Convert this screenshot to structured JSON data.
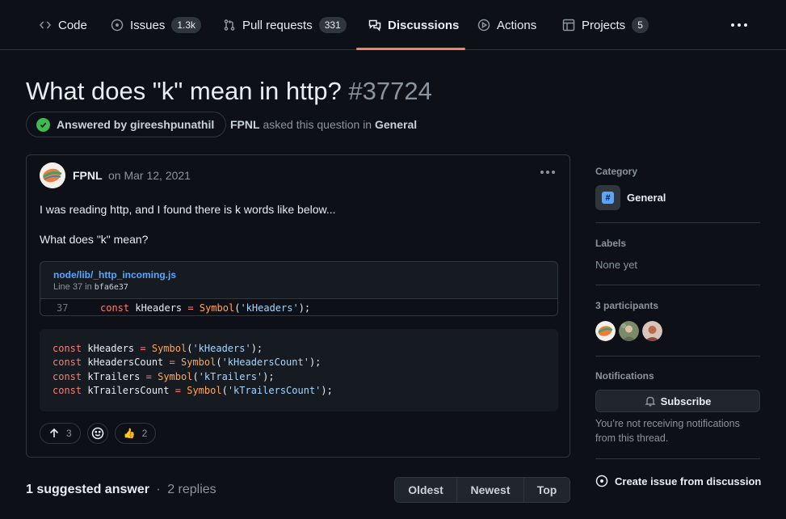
{
  "nav": {
    "tabs": [
      {
        "label": "Code",
        "icon": "code-icon"
      },
      {
        "label": "Issues",
        "icon": "issue-icon",
        "count": "1.3k"
      },
      {
        "label": "Pull requests",
        "icon": "pull-request-icon",
        "count": "331"
      },
      {
        "label": "Discussions",
        "icon": "discussion-icon",
        "active": true
      },
      {
        "label": "Actions",
        "icon": "play-icon"
      },
      {
        "label": "Projects",
        "icon": "table-icon",
        "count": "5"
      }
    ]
  },
  "discussion": {
    "title": "What does \"k\" mean in http?",
    "number": "#37724",
    "answered_by": "Answered by gireeshpunathil",
    "asker": "FPNL",
    "asked_text": "asked this question in",
    "category": "General"
  },
  "post": {
    "author": "FPNL",
    "date": "on Mar 12, 2021",
    "paragraph1": "I was reading http, and I found there is k words like below...",
    "paragraph2": "What does \"k\" mean?",
    "snippet": {
      "file": "node/lib/_http_incoming.js",
      "line_prefix": "Line 37 in",
      "commit": "bfa6e37",
      "line_number": "37",
      "code": {
        "kw": "const",
        "var": "kHeaders",
        "fn": "Symbol",
        "arg": "'kHeaders'"
      }
    },
    "codeblock": [
      {
        "kw": "const",
        "var": "kHeaders",
        "fn": "Symbol",
        "arg": "'kHeaders'"
      },
      {
        "kw": "const",
        "var": "kHeadersCount",
        "fn": "Symbol",
        "arg": "'kHeadersCount'"
      },
      {
        "kw": "const",
        "var": "kTrailers",
        "fn": "Symbol",
        "arg": "'kTrailers'"
      },
      {
        "kw": "const",
        "var": "kTrailersCount",
        "fn": "Symbol",
        "arg": "'kTrailersCount'"
      }
    ],
    "upvotes": "3",
    "thumbs_up": "2",
    "thumbs_emoji": "👍"
  },
  "answers": {
    "suggested": "1 suggested answer",
    "separator": "·",
    "replies": "2 replies",
    "sort_options": [
      "Oldest",
      "Newest",
      "Top"
    ]
  },
  "sidebar": {
    "category_heading": "Category",
    "category_name": "General",
    "category_icon_glyph": "#",
    "labels_heading": "Labels",
    "labels_value": "None yet",
    "participants_heading": "3 participants",
    "notifications_heading": "Notifications",
    "subscribe_label": "Subscribe",
    "notif_text": "You’re not receiving notifications from this thread.",
    "create_issue_label": "Create issue from discussion"
  },
  "colors": {
    "background": "#0d1117",
    "border": "#30363d",
    "accent_underline": "#f78166",
    "success": "#3fb950",
    "link": "#58a6ff"
  }
}
